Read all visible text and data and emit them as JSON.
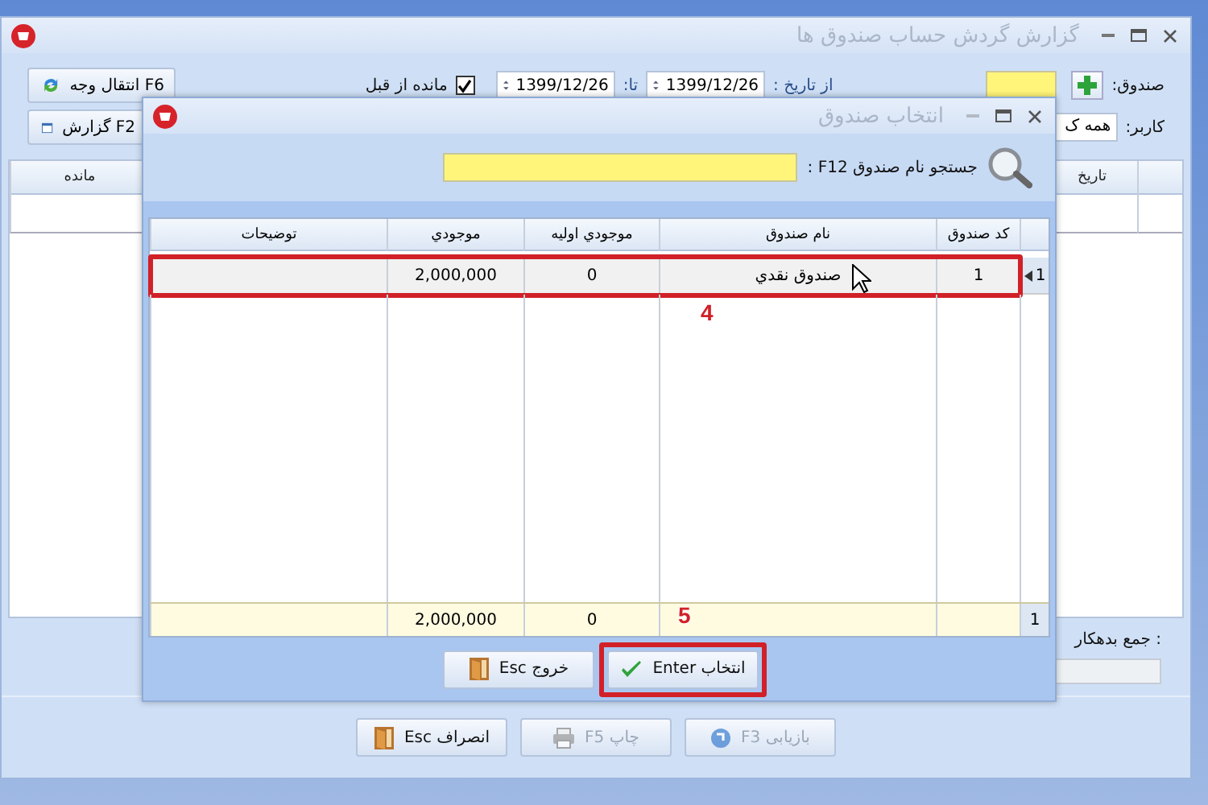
{
  "main_window": {
    "title": "گزارش گردش حساب صندوق ها",
    "fund_label": "صندوق:",
    "from_label": "از تاریخ :",
    "from_date": "1399/12/26",
    "to_label": "تا:",
    "to_date": "1399/12/26",
    "carry_over": {
      "label": "مانده از قبل",
      "checked": true
    },
    "user_label": "کاربر:",
    "user_value": "همه ک",
    "side_buttons": [
      {
        "label": "انتقال وجه F6",
        "kind": "transfer"
      },
      {
        "label": "گزارش F2",
        "kind": "report"
      }
    ],
    "columns": [
      {
        "header": "تاریخ"
      },
      {
        "header": "مانده"
      }
    ],
    "debit_label": "جمع بدهکار :",
    "buttons": [
      {
        "label": "بازیابی F3",
        "kind": "restore",
        "disabled": true
      },
      {
        "label": "چاپ F5",
        "kind": "print",
        "disabled": true
      },
      {
        "label": "انصراف Esc",
        "kind": "exit",
        "disabled": false
      }
    ]
  },
  "dialog": {
    "title": "انتخاب صندوق",
    "search": {
      "label": "جستجو نام صندوق F12 :"
    },
    "columns": [
      {
        "header": "کد صندوق"
      },
      {
        "header": "نام صندوق"
      },
      {
        "header": "موجودي اوليه"
      },
      {
        "header": "موجودي"
      },
      {
        "header": "توضيحات"
      }
    ],
    "rows": [
      {
        "marker": "1",
        "cells": [
          "1",
          "صندوق نقدي",
          "0",
          "2,000,000"
        ],
        "selected": true,
        "annotation": "4"
      }
    ],
    "totals": {
      "marker": "1",
      "initial": "0",
      "balance": "2,000,000"
    },
    "buttons": [
      {
        "label": "انتخاب Enter",
        "kind": "confirm",
        "annotation": "5"
      },
      {
        "label": "خروج Esc",
        "kind": "exit"
      }
    ]
  }
}
